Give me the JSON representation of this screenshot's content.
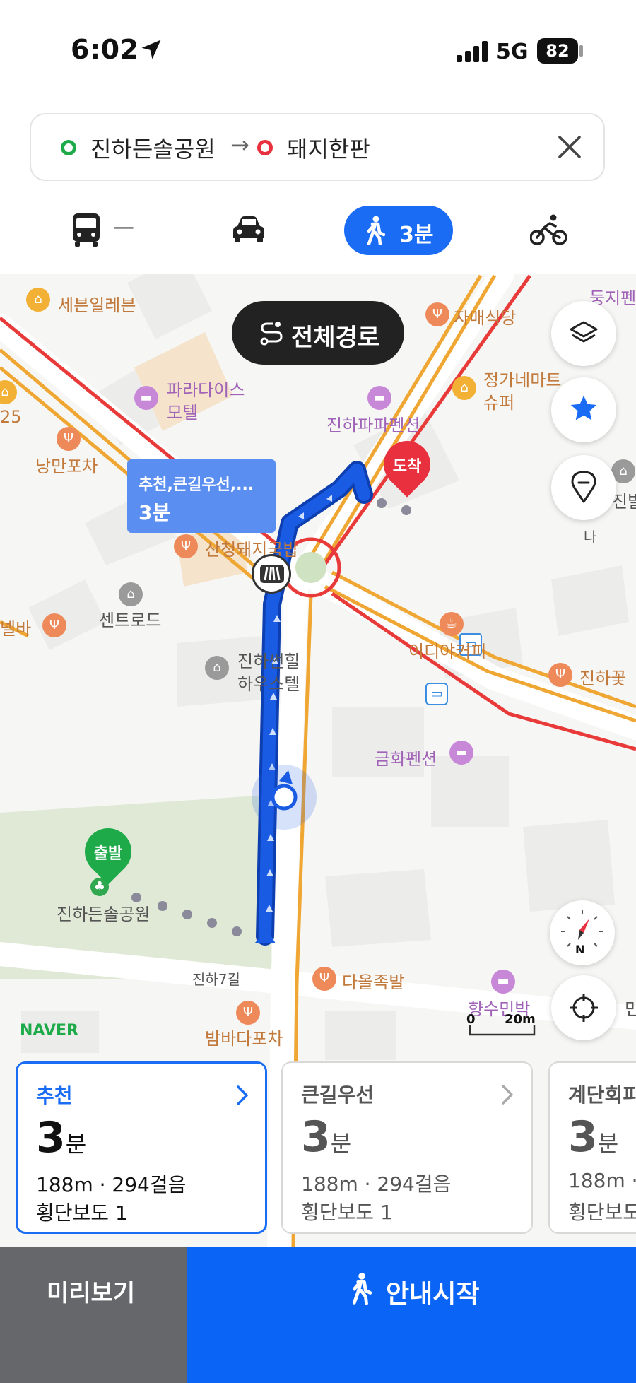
{
  "status_bar": {
    "time": "6:02",
    "network": "5G",
    "battery": "82"
  },
  "search": {
    "origin": "진하든솔공원",
    "destination": "돼지한판",
    "arrow": "→"
  },
  "modes": {
    "transit_label": "—",
    "walk_label": "3분"
  },
  "map": {
    "full_route_label": "전체경로",
    "route_bubble": {
      "title": "추천,큰길우선,...",
      "time": "3분"
    },
    "start_pin": "출발",
    "end_pin": "도착",
    "labels": {
      "seven_eleven": "세븐일레븐",
      "paradise_1": "파라다이스",
      "paradise_2": "모텔",
      "nangman": "낭만포차",
      "sancheong": "산청돼지국밥",
      "central_road": "센트로드",
      "nelba": "넬바",
      "sunhill_1": "진하썬힐",
      "sunhill_2": "하우스텔",
      "jamae": "자매식당",
      "jeongga_1": "정가네마트",
      "jeongga_2": "슈퍼",
      "papa": "진하파파펜션",
      "ediya": "이디야커피",
      "geumhwa": "금화펜션",
      "jinha_flower": "진하꽃",
      "dugji": "둥지펜",
      "park": "진하든솔공원",
      "road7": "진하7길",
      "daol": "다올족발",
      "bamba": "밤바다포차",
      "hyangsu": "향수민박",
      "num25": "25",
      "na": "나",
      "jinbal": "진발",
      "min": "민"
    },
    "scale_zero": "0",
    "scale_dist": "20m",
    "brand": "NAVER",
    "compass_letter": "N"
  },
  "cards": [
    {
      "title": "추천",
      "minutes": "3",
      "unit": "분",
      "distance": "188m · 294걸음",
      "crosswalk": "횡단보도 1"
    },
    {
      "title": "큰길우선",
      "minutes": "3",
      "unit": "분",
      "distance": "188m · 294걸음",
      "crosswalk": "횡단보도 1"
    },
    {
      "title": "계단회피",
      "minutes": "3",
      "unit": "분",
      "distance": "188m ·",
      "crosswalk": "횡단보도"
    }
  ],
  "bottom": {
    "preview": "미리보기",
    "start": "안내시작"
  },
  "colors": {
    "accent": "#1a6cf5",
    "route": "#1450d8",
    "start_pin": "#1faa4a",
    "end_pin": "#e8303f"
  }
}
